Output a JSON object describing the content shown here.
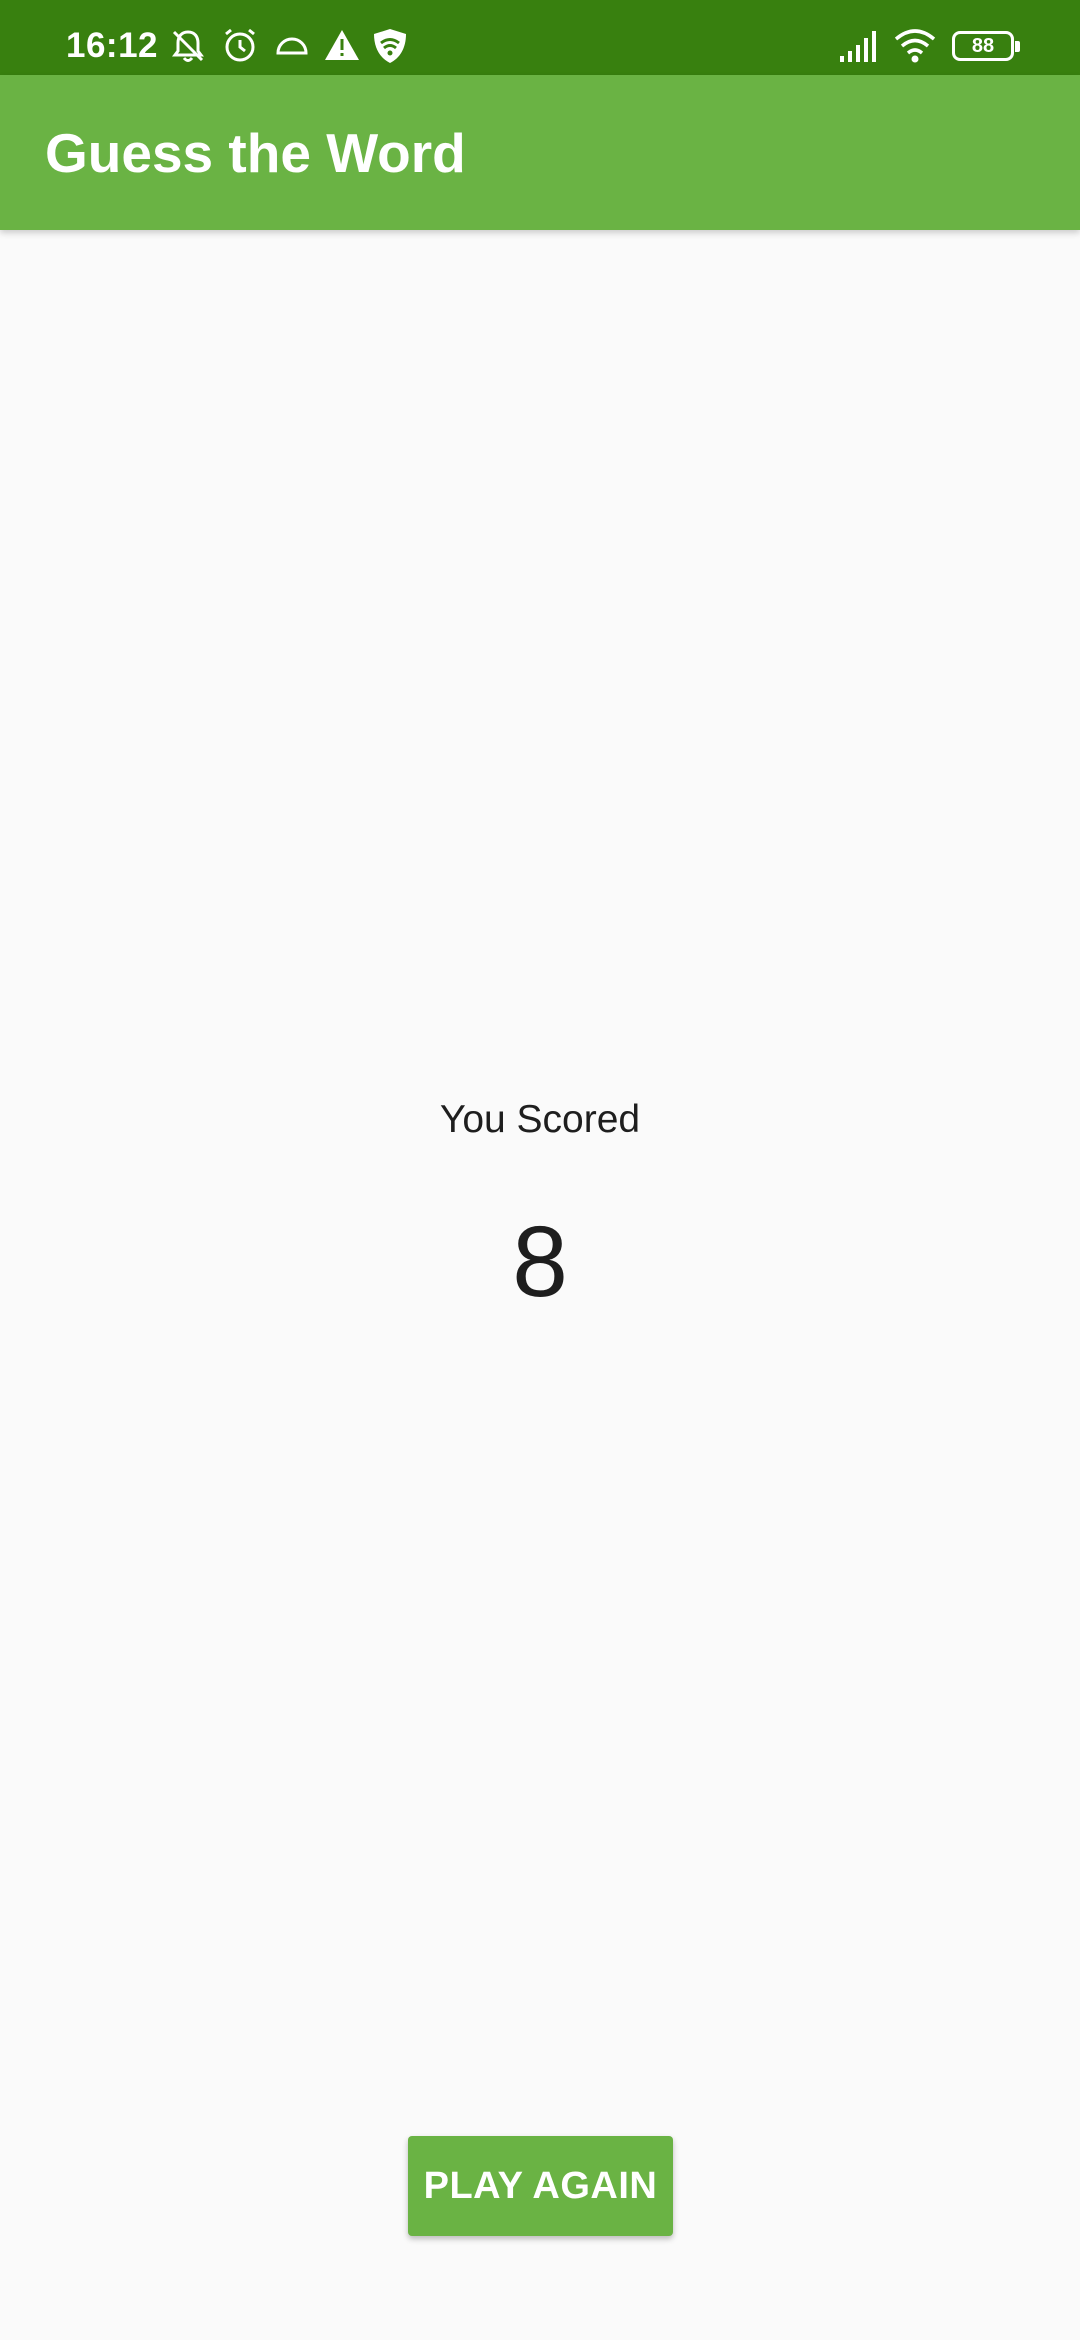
{
  "status_bar": {
    "time": "16:12",
    "battery_level": "88",
    "left_icons": [
      "muted-bell-icon",
      "alarm-icon",
      "half-circle-icon",
      "warning-icon",
      "shield-wifi-icon"
    ],
    "right_icons": [
      "signal-icon",
      "wifi-icon",
      "battery-icon"
    ]
  },
  "app_bar": {
    "title": "Guess the Word",
    "color": "#6ab344"
  },
  "score": {
    "label": "You Scored",
    "value": "8"
  },
  "actions": {
    "play_again_label": "PLAY AGAIN"
  },
  "colors": {
    "status_bar": "#38800f",
    "accent": "#6ab344",
    "background": "#fafafa"
  }
}
